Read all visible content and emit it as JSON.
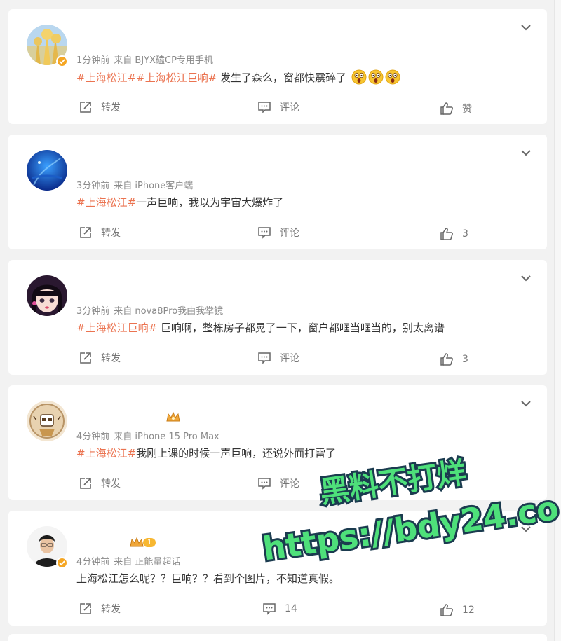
{
  "labels": {
    "forward": "转发",
    "comment": "评论",
    "like": "赞"
  },
  "posts": [
    {
      "time": "1分钟前",
      "source": "来自 BJYX磕CP专用手机",
      "tags": [
        "#上海松江#",
        "#上海松江巨响#"
      ],
      "text": " 发生了森么，窗都快震碎了",
      "emoji_count": 3,
      "comment_count": "",
      "like_count": ""
    },
    {
      "time": "3分钟前",
      "source": "来自 iPhone客户端",
      "tags": [
        "#上海松江#"
      ],
      "text": "一声巨响，我以为宇宙大爆炸了",
      "emoji_count": 0,
      "comment_count": "",
      "like_count": "3"
    },
    {
      "time": "3分钟前",
      "source": "来自 nova8Pro我由我掌镜",
      "tags": [
        "#上海松江巨响#"
      ],
      "text": " 巨响啊，整栋房子都晃了一下，窗户都哐当哐当的，别太离谱",
      "emoji_count": 0,
      "comment_count": "",
      "like_count": "3"
    },
    {
      "time": "4分钟前",
      "source": "来自 iPhone 15 Pro Max",
      "tags": [
        "#上海松江#"
      ],
      "text": "我刚上课的时候一声巨响，还说外面打雷了",
      "emoji_count": 0,
      "comment_count": "",
      "like_count": ""
    },
    {
      "time": "4分钟前",
      "source": "来自 正能量超话",
      "tags": [],
      "text": "上海松江怎么呢？？巨响？？看到个图片，不知道真假。",
      "emoji_count": 0,
      "comment_count": "14",
      "like_count": "12"
    }
  ],
  "badges": {
    "level_badge": "1"
  },
  "watermark": {
    "line1": "黑料不打烊",
    "line2": "https://bdy24.co"
  },
  "colors": {
    "tag": "#eb7350",
    "watermark_fill": "#4ee07a",
    "watermark_stroke": "#1b3b4f"
  }
}
